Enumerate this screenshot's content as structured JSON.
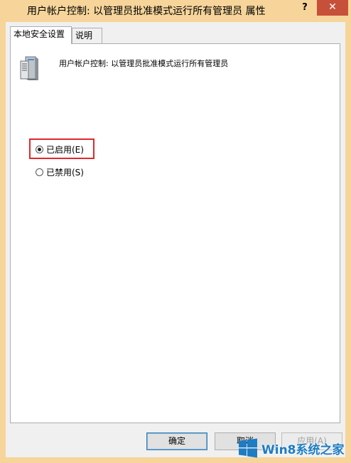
{
  "window": {
    "title": "用户帐户控制: 以管理员批准模式运行所有管理员 属性",
    "help_label": "?",
    "close_label": "✕"
  },
  "tabs": [
    {
      "label": "本地安全设置",
      "active": true
    },
    {
      "label": "说明",
      "active": false
    }
  ],
  "policy": {
    "icon": "server-icon",
    "name": "用户帐户控制: 以管理员批准模式运行所有管理员"
  },
  "options": [
    {
      "label": "已启用(E)",
      "selected": true
    },
    {
      "label": "已禁用(S)",
      "selected": false
    }
  ],
  "buttons": {
    "ok": "确定",
    "cancel": "取消",
    "apply": "应用(A)"
  },
  "watermark": {
    "text": "Win8系统之家",
    "icon": "windows-logo-icon"
  },
  "colors": {
    "frame": "#f6d49a",
    "close": "#c7503a",
    "highlight": "#e0282c",
    "watermark": "#1c7cc4"
  }
}
